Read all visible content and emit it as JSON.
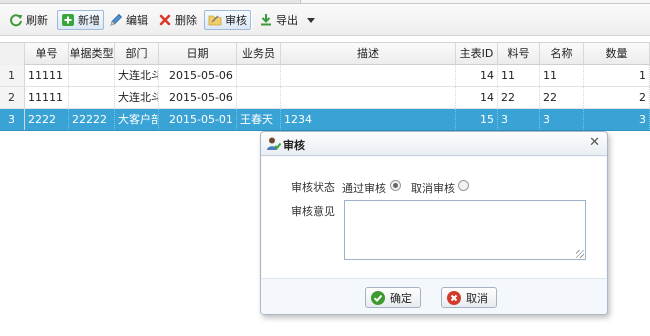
{
  "toolbar": {
    "refresh": "刷新",
    "add": "新增",
    "edit": "编辑",
    "delete": "删除",
    "audit": "审核",
    "export": "导出"
  },
  "grid": {
    "columns": [
      "单号",
      "单据类型",
      "部门",
      "日期",
      "业务员",
      "描述",
      "主表ID",
      "料号",
      "名称",
      "数量"
    ],
    "rows": [
      {
        "rownum": "1",
        "cells": [
          "11111",
          "",
          "大连北斗",
          "2015-05-06",
          "",
          "",
          "14",
          "11",
          "11",
          "1"
        ]
      },
      {
        "rownum": "2",
        "cells": [
          "11111",
          "",
          "大连北斗",
          "2015-05-06",
          "",
          "",
          "14",
          "22",
          "22",
          "2"
        ]
      },
      {
        "rownum": "3",
        "cells": [
          "2222",
          "22222",
          "大客户部",
          "2015-05-01",
          "王春天",
          "1234",
          "15",
          "3",
          "3",
          "3"
        ]
      }
    ],
    "selected_row": "3"
  },
  "dialog": {
    "title": "审核",
    "status_label": "审核状态",
    "option_approve": "通过审核",
    "option_cancel": "取消审核",
    "opinion_label": "审核意见",
    "opinion_value": "",
    "ok_label": "确定",
    "cancel_label": "取消"
  },
  "colors": {
    "selected_row": "#3aa3d6",
    "ok_icon": "#3c9a2e",
    "cancel_icon": "#d23b2a"
  }
}
